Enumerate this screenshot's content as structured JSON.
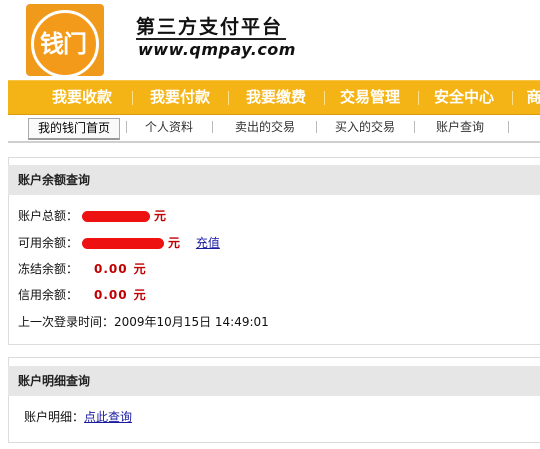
{
  "header": {
    "logo_text": "钱门",
    "brand_title": "第三方支付平台",
    "brand_url": "www.qmpay.com"
  },
  "main_nav": [
    "我要收款",
    "我要付款",
    "我要缴费",
    "交易管理",
    "安全中心",
    "商"
  ],
  "sub_nav": [
    "我的钱门首页",
    "个人资料",
    "卖出的交易",
    "买入的交易",
    "账户查询"
  ],
  "balance_panel": {
    "title": "账户余额查询",
    "total_label": "账户总额：",
    "total_unit": "元",
    "available_label": "可用余额：",
    "available_unit": "元",
    "recharge_link": "充值",
    "frozen_label": "冻结余额：",
    "frozen_value": "0.00",
    "frozen_unit": "元",
    "credit_label": "信用余额：",
    "credit_value": "0.00",
    "credit_unit": "元",
    "last_login": "上一次登录时间：2009年10月15日 14:49:01"
  },
  "detail_panel": {
    "title": "账户明细查询",
    "detail_label": "账户明细：",
    "detail_link": "点此查询"
  },
  "colors": {
    "nav_bg": "#f5b416",
    "logo_bg": "#f09a1c",
    "amount_red": "#c00000",
    "redaction": "#ee1111",
    "link": "#1a1aa0"
  }
}
